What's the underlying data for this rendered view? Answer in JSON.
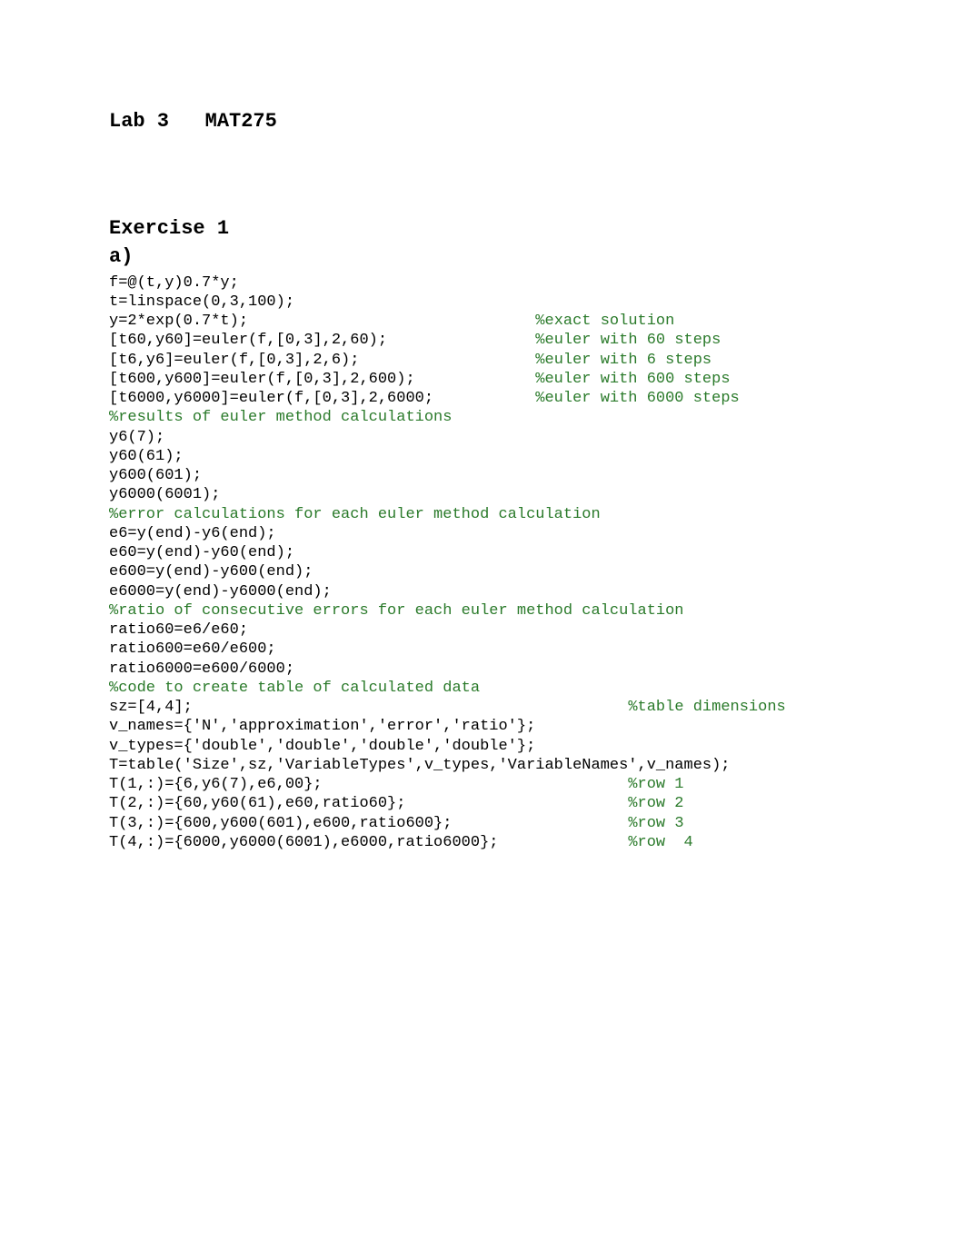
{
  "title": "Lab 3   MAT275",
  "section_heading": "Exercise 1",
  "subsection_heading": "a)",
  "code_lines": [
    {
      "text": "f=@(t,y)0.7*y;",
      "comment": ""
    },
    {
      "text": "t=linspace(0,3,100);",
      "comment": ""
    },
    {
      "text": "y=2*exp(0.7*t);",
      "comment": "%exact solution"
    },
    {
      "text": "[t60,y60]=euler(f,[0,3],2,60);",
      "comment": "%euler with 60 steps"
    },
    {
      "text": "[t6,y6]=euler(f,[0,3],2,6);",
      "comment": "%euler with 6 steps"
    },
    {
      "text": "[t600,y600]=euler(f,[0,3],2,600);",
      "comment": "%euler with 600 steps"
    },
    {
      "text": "[t6000,y6000]=euler(f,[0,3],2,6000;",
      "comment": "%euler with 6000 steps"
    },
    {
      "text": "",
      "comment": "%results of euler method calculations"
    },
    {
      "text": "y6(7);",
      "comment": ""
    },
    {
      "text": "y60(61);",
      "comment": ""
    },
    {
      "text": "y600(601);",
      "comment": ""
    },
    {
      "text": "y6000(6001);",
      "comment": ""
    },
    {
      "text": "",
      "comment": "%error calculations for each euler method calculation"
    },
    {
      "text": "e6=y(end)-y6(end);",
      "comment": ""
    },
    {
      "text": "e60=y(end)-y60(end);",
      "comment": ""
    },
    {
      "text": "e600=y(end)-y600(end);",
      "comment": ""
    },
    {
      "text": "e6000=y(end)-y6000(end);",
      "comment": ""
    },
    {
      "text": "",
      "comment": "%ratio of consecutive errors for each euler method calculation"
    },
    {
      "text": "ratio60=e6/e60;",
      "comment": ""
    },
    {
      "text": "ratio600=e60/e600;",
      "comment": ""
    },
    {
      "text": "ratio6000=e600/6000;",
      "comment": ""
    },
    {
      "text": "",
      "comment": "%code to create table of calculated data"
    },
    {
      "text": "sz=[4,4];",
      "comment": "%table dimensions"
    },
    {
      "text": "v_names={'N','approximation','error','ratio'};",
      "comment": ""
    },
    {
      "text": "v_types={'double','double','double','double'};",
      "comment": ""
    },
    {
      "text": "T=table('Size',sz,'VariableTypes',v_types,'VariableNames',v_names);",
      "comment": ""
    },
    {
      "text": "T(1,:)={6,y6(7),e6,00};",
      "comment": "%row 1"
    },
    {
      "text": "T(2,:)={60,y60(61),e60,ratio60};",
      "comment": "%row 2"
    },
    {
      "text": "T(3,:)={600,y600(601),e600,ratio600};",
      "comment": "%row 3"
    },
    {
      "text": "T(4,:)={6000,y6000(6001),e6000,ratio6000};",
      "comment": "%row  4"
    }
  ],
  "comment_columns": {
    "default": 46,
    "overrides": {
      "22": 56,
      "26": 56,
      "27": 56,
      "28": 56,
      "29": 56
    }
  },
  "colors": {
    "code": "#000000",
    "comment": "#2a7a2a"
  }
}
